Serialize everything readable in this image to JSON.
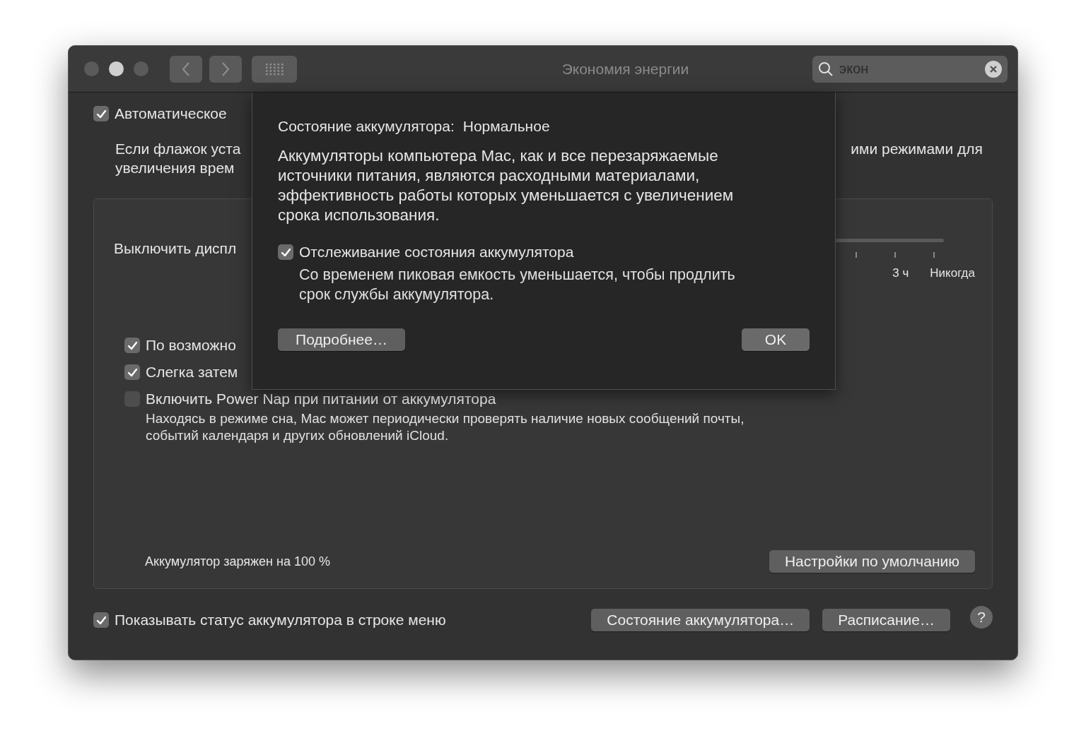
{
  "window": {
    "title": "Экономия энергии",
    "search": {
      "value": "экон"
    }
  },
  "top_option": {
    "label": "Автоматическое",
    "checked": true
  },
  "description": {
    "left_lines": [
      "Если флажок уста",
      "увеличения врем"
    ],
    "right_fragment": "ими режимами для"
  },
  "panel": {
    "display_off_label": "Выключить диспл",
    "slider_labels": [
      "3 ч",
      "Никогда"
    ],
    "options": [
      {
        "label": "По возможно",
        "checked": true
      },
      {
        "label": "Слегка затем",
        "checked": true
      },
      {
        "label": "Включить Power Nap при питании от аккумулятора",
        "checked": false,
        "description": "Находясь в режиме сна, Mac может периодически проверять наличие новых сообщений почты, событий календаря и других обновлений iCloud."
      }
    ],
    "charge_text": "Аккумулятор заряжен на 100 %",
    "defaults_button": "Настройки по умолчанию"
  },
  "footer": {
    "menu_status": {
      "label": "Показывать статус аккумулятора в строке меню",
      "checked": true
    },
    "buttons": [
      "Состояние аккумулятора…",
      "Расписание…"
    ],
    "help": "?"
  },
  "sheet": {
    "status_label": "Состояние аккумулятора:",
    "status_value": "Нормальное",
    "text": "Аккумуляторы компьютера Mac, как и все перезаряжаемые источники питания, являются расходными материалами, эффективность работы которых уменьшается с увеличением срока использования.",
    "option": {
      "label": "Отслеживание состояния аккумулятора",
      "checked": true,
      "description": "Со временем пиковая емкость уменьшается, чтобы продлить срок службы аккумулятора."
    },
    "buttons": [
      {
        "label": "Подробнее…",
        "kind": "secondary"
      },
      {
        "label": "OK",
        "kind": "default"
      }
    ]
  }
}
